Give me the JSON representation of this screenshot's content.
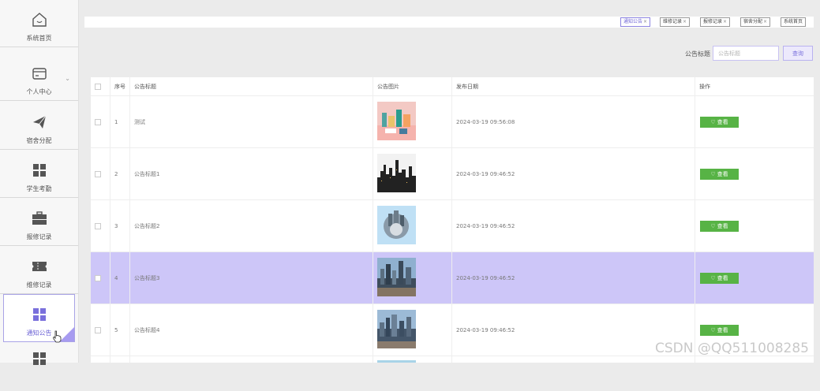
{
  "sidebar": {
    "items": [
      {
        "label": "系统首页",
        "icon": "home-icon"
      },
      {
        "label": "个人中心",
        "icon": "id-card-icon",
        "has_arrow": true
      },
      {
        "label": "宿舍分配",
        "icon": "paper-plane-icon"
      },
      {
        "label": "学生考勤",
        "icon": "grid-icon"
      },
      {
        "label": "报修记录",
        "icon": "briefcase-icon"
      },
      {
        "label": "维修记录",
        "icon": "ticket-icon"
      },
      {
        "label": "通知公告",
        "icon": "grid-icon",
        "active": true
      },
      {
        "label": "",
        "icon": "grid-icon"
      }
    ]
  },
  "tabs": [
    {
      "label": "通知公告",
      "close": "×",
      "active": true
    },
    {
      "label": "维修记录",
      "close": "×"
    },
    {
      "label": "报修记录",
      "close": "×"
    },
    {
      "label": "宿舍分配",
      "close": "×"
    },
    {
      "label": "系统首页",
      "close": ""
    }
  ],
  "search": {
    "label": "公告标题",
    "placeholder": "公告标题",
    "button": "查询"
  },
  "table": {
    "columns": {
      "index": "序号",
      "title": "公告标题",
      "image": "公告图片",
      "date": "发布日期",
      "op": "操作"
    },
    "view_label": "查看",
    "rows": [
      {
        "index": "1",
        "title": "测试",
        "date": "2024-03-19 09:56:08",
        "image": "toy-scene"
      },
      {
        "index": "2",
        "title": "公告标题1",
        "date": "2024-03-19 09:46:52",
        "image": "city-silhouette"
      },
      {
        "index": "3",
        "title": "公告标题2",
        "date": "2024-03-19 09:46:52",
        "image": "tiny-planet"
      },
      {
        "index": "4",
        "title": "公告标题3",
        "date": "2024-03-19 09:46:52",
        "image": "city-skyline",
        "selected": true
      },
      {
        "index": "5",
        "title": "公告标题4",
        "date": "2024-03-19 09:46:52",
        "image": "city-skyline"
      }
    ]
  },
  "watermark": "CSDN @QQ511008285",
  "colors": {
    "accent": "#6e64d6",
    "selected_row": "#cdc6f8",
    "view_button": "#57b345"
  }
}
